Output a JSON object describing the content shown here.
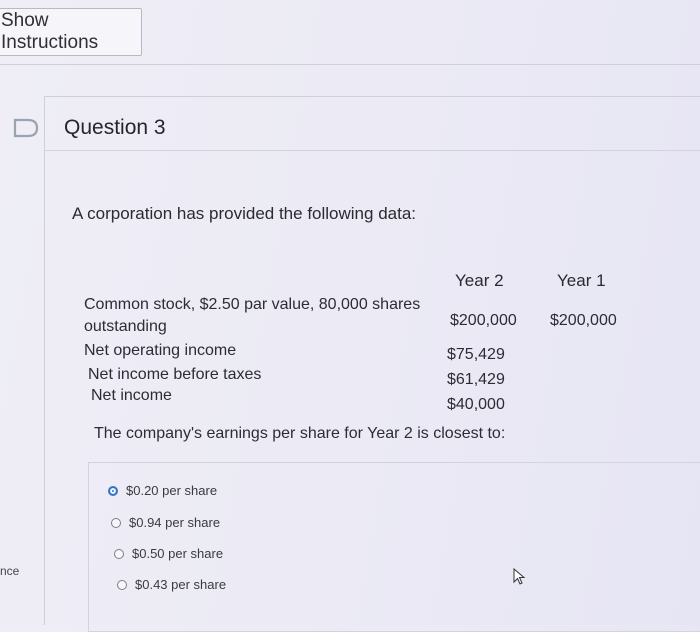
{
  "toolbar": {
    "show_instructions": "Show Instructions"
  },
  "question": {
    "title": "Question 3",
    "intro": "A corporation has provided the following data:",
    "columns": [
      "Year 2",
      "Year 1"
    ],
    "rows": [
      {
        "label_line1": "Common stock, $2.50 par value, 80,000 shares",
        "label_line2": "outstanding",
        "year2": "$200,000",
        "year1": "$200,000"
      },
      {
        "label": "Net operating income",
        "year2": "$75,429"
      },
      {
        "label": "Net income before taxes",
        "year2": "$61,429"
      },
      {
        "label": "Net income",
        "year2": "$40,000"
      }
    ],
    "prompt": "The company's earnings per share for Year 2 is closest to:",
    "options": [
      "$0.20 per share",
      "$0.94 per share",
      "$0.50 per share",
      "$0.43 per share"
    ],
    "selected_index": 0
  },
  "sidebar_fragment": "nce",
  "icons": {
    "flag": "flag-icon",
    "cursor": "mouse-pointer-icon"
  },
  "colors": {
    "selected_radio": "#2f74c9"
  }
}
